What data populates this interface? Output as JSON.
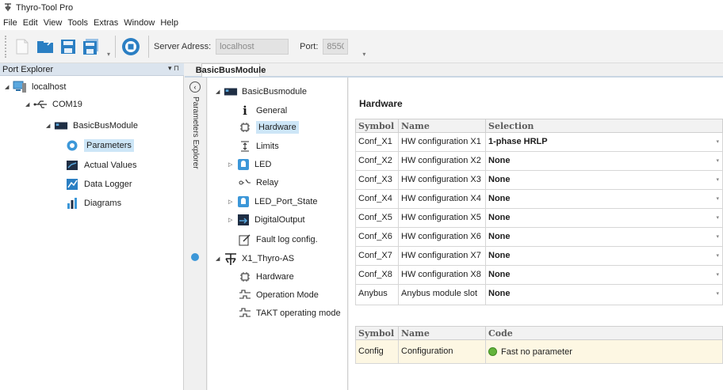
{
  "app": {
    "title": "Thyro-Tool Pro"
  },
  "menu": [
    "File",
    "Edit",
    "View",
    "Tools",
    "Extras",
    "Window",
    "Help"
  ],
  "toolbar": {
    "server_label": "Server Adress:",
    "server_value": "localhost",
    "port_label": "Port:",
    "port_value": "8550"
  },
  "port_explorer": {
    "title": "Port Explorer",
    "ctrl": "▾ ⊓",
    "tree": [
      {
        "label": "localhost",
        "icon": "computer-icon"
      },
      {
        "label": "COM19",
        "icon": "usb-port-icon"
      },
      {
        "label": "BasicBusModule",
        "icon": "module-icon"
      },
      {
        "label": "Parameters",
        "icon": "gear-icon"
      },
      {
        "label": "Actual Values",
        "icon": "meter-icon"
      },
      {
        "label": "Data Logger",
        "icon": "logger-icon"
      },
      {
        "label": "Diagrams",
        "icon": "bar-chart-icon"
      }
    ]
  },
  "side_tab": {
    "label": "Parameters Explorer"
  },
  "doc_tab": {
    "label": "BasicBusModule"
  },
  "param_tree": [
    {
      "label": "BasicBusmodule",
      "icon": "module-icon"
    },
    {
      "label": "General",
      "icon": "info-icon"
    },
    {
      "label": "Hardware",
      "icon": "chip-icon"
    },
    {
      "label": "Limits",
      "icon": "limits-icon"
    },
    {
      "label": "LED",
      "icon": "led-icon"
    },
    {
      "label": "Relay",
      "icon": "relay-icon"
    },
    {
      "label": "LED_Port_State",
      "icon": "led-icon"
    },
    {
      "label": "DigitalOutput",
      "icon": "digital-output-icon"
    },
    {
      "label": "Fault log config.",
      "icon": "edit-icon"
    },
    {
      "label": "X1_Thyro-AS",
      "icon": "thyristor-icon"
    },
    {
      "label": "Hardware",
      "icon": "chip-icon"
    },
    {
      "label": "Operation Mode",
      "icon": "waveform-icon"
    },
    {
      "label": "TAKT operating mode",
      "icon": "waveform-icon"
    }
  ],
  "hardware": {
    "title": "Hardware",
    "columns": [
      "Symbol",
      "Name",
      "Selection"
    ],
    "rows": [
      {
        "symbol": "Conf_X1",
        "name": "HW configuration X1",
        "selection": "1-phase HRLP"
      },
      {
        "symbol": "Conf_X2",
        "name": "HW configuration X2",
        "selection": "None"
      },
      {
        "symbol": "Conf_X3",
        "name": "HW configuration X3",
        "selection": "None"
      },
      {
        "symbol": "Conf_X4",
        "name": "HW configuration X4",
        "selection": "None"
      },
      {
        "symbol": "Conf_X5",
        "name": "HW configuration X5",
        "selection": "None"
      },
      {
        "symbol": "Conf_X6",
        "name": "HW configuration X6",
        "selection": "None"
      },
      {
        "symbol": "Conf_X7",
        "name": "HW configuration X7",
        "selection": "None"
      },
      {
        "symbol": "Conf_X8",
        "name": "HW configuration X8",
        "selection": "None"
      },
      {
        "symbol": "Anybus",
        "name": "Anybus module slot",
        "selection": "None"
      }
    ],
    "config_columns": [
      "Symbol",
      "Name",
      "Code"
    ],
    "config_row": {
      "symbol": "Config",
      "name": "Configuration",
      "code": "Fast no parameter",
      "status_color": "#64b33b"
    }
  },
  "colors": {
    "accent": "#3c97d8",
    "selection_bg": "#cde6f7",
    "config_bg": "#fdf7e3"
  }
}
